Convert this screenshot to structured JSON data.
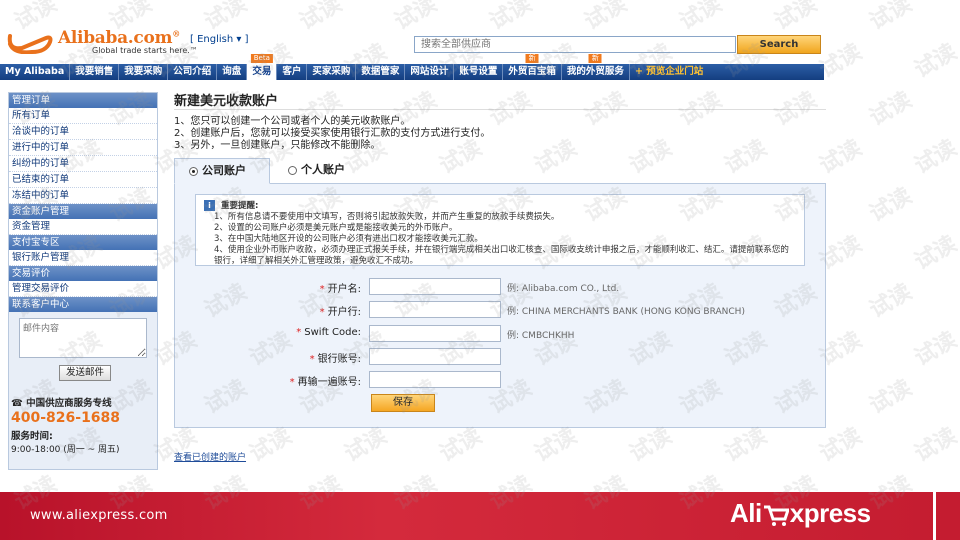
{
  "header": {
    "logo_word": "Alibaba.com",
    "logo_sup": "®",
    "tagline": "Global trade starts here.™",
    "language": "[ English ▾ ]",
    "search_placeholder": "搜索全部供应商",
    "search_button": "Search"
  },
  "nav": {
    "items": [
      {
        "label": "My Alibaba"
      },
      {
        "label": "我要销售"
      },
      {
        "label": "我要采购"
      },
      {
        "label": "公司介绍"
      },
      {
        "label": "询盘"
      },
      {
        "label": "交易",
        "badge": "Beta",
        "active": true
      },
      {
        "label": "客户"
      },
      {
        "label": "买家采购"
      },
      {
        "label": "数据管家"
      },
      {
        "label": "网站设计"
      },
      {
        "label": "账号设置"
      },
      {
        "label": "外贸百宝箱",
        "badge": "新"
      },
      {
        "label": "我的外贸服务",
        "badge": "新"
      }
    ],
    "promo": "+ 预览企业门站"
  },
  "sidebar": {
    "sections": [
      {
        "title": "管理订单",
        "items": [
          "所有订单",
          "洽谈中的订单",
          "进行中的订单",
          "纠纷中的订单",
          "已结束的订单",
          "冻结中的订单"
        ]
      },
      {
        "title": "资金账户管理",
        "items": [
          "资金管理"
        ]
      },
      {
        "title": "支付宝专区",
        "items": [
          "银行账户管理"
        ]
      },
      {
        "title": "交易评价",
        "items": [
          "管理交易评价"
        ]
      },
      {
        "title": "联系客户中心",
        "items": []
      }
    ],
    "mail_placeholder": "邮件内容",
    "send_button": "发送邮件",
    "hotline_label": "中国供应商服务专线",
    "hotline_phone": "400-826-1688",
    "hours_label": "服务时间:",
    "hours": "9:00-18:00 (周一 ~ 周五)"
  },
  "main": {
    "title": "新建美元收款账户",
    "intro": [
      "1、您只可以创建一个公司或者个人的美元收款账户。",
      "2、创建账户后，您就可以接受买家使用银行汇款的支付方式进行支付。",
      "3、另外，一旦创建账户，只能修改不能删除。"
    ],
    "tabs": [
      {
        "label": "公司账户",
        "selected": true
      },
      {
        "label": "个人账户",
        "selected": false
      }
    ],
    "notice": {
      "title": "重要提醒:",
      "lines": [
        "1、所有信息请不要使用中文填写，否则将引起放款失败，并而产生重复的放款手续费损失。",
        "2、设置的公司账户必须是美元账户或是能接收美元的外币账户。",
        "3、在中国大陆地区开设的公司账户必须有进出口权才能接收美元汇款。",
        "4、使用企业外币账户收款，必须办理正式报关手续，并在银行端完成相关出口收汇核查、国际收支统计申报之后，才能顺利收汇、结汇。请提前联系您的银行，详细了解相关外汇管理政策，避免收汇不成功。"
      ]
    },
    "fields": [
      {
        "label": "开户名:",
        "required": true,
        "hint": "例: Alibaba.com CO., Ltd."
      },
      {
        "label": "开户行:",
        "required": true,
        "hint": "例: CHINA MERCHANTS BANK (HONG KONG BRANCH)"
      },
      {
        "label": "Swift Code:",
        "required": true,
        "hint": "例: CMBCHKHH"
      },
      {
        "label": "银行账号:",
        "required": true,
        "hint": ""
      },
      {
        "label": "再输一遍账号:",
        "required": true,
        "hint": ""
      }
    ],
    "save_button": "保存",
    "view_created_link": "查看已创建的账户"
  },
  "footer": {
    "url": "www.aliexpress.com",
    "logo_left": "Ali",
    "logo_right": "xpress"
  },
  "watermark_text": "试读",
  "colors": {
    "nav_blue": "#1d4a8f",
    "accent_orange": "#e9711c",
    "footer_red": "#c41c30"
  }
}
